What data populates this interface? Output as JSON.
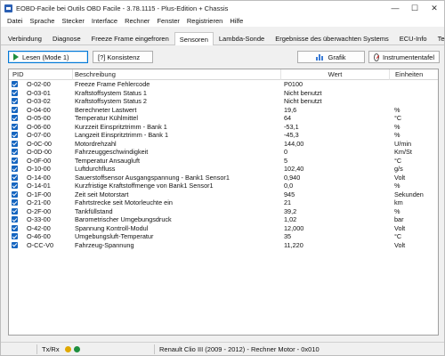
{
  "window": {
    "title": "EOBD-Facile bei Outils OBD Facile - 3.78.1115 - Plus-Edition + Chassis",
    "controls": {
      "minimize": "—",
      "maximize": "☐",
      "close": "✕"
    }
  },
  "menu": [
    "Datei",
    "Sprache",
    "Stecker",
    "Interface",
    "Rechner",
    "Fenster",
    "Registrieren",
    "Hilfe"
  ],
  "tabs": [
    "Verbindung",
    "Diagnose",
    "Freeze Frame eingefroren",
    "Sensoren",
    "Lambda-Sonde",
    "Ergebnisse des überwachten Systems",
    "ECU-Info",
    "Terminal"
  ],
  "active_tab": "Sensoren",
  "toolbar": {
    "read_label": "Lesen (Mode 1)",
    "consistency_label": "[?] Konsistenz",
    "chart_label": "Grafik",
    "dashboard_label": "Instrumententafel"
  },
  "table": {
    "columns": {
      "pid": "PID",
      "desc": "Beschreibung",
      "value": "Wert",
      "unit": "Einheiten"
    },
    "rows": [
      {
        "pid": "O-02-00",
        "desc": "Freeze Frame Fehlercode",
        "value": "P0100",
        "unit": ""
      },
      {
        "pid": "O-03-01",
        "desc": "Kraftstoffsystem Status 1",
        "value": "Nicht benutzt",
        "unit": ""
      },
      {
        "pid": "O-03-02",
        "desc": "Kraftstoffsystem Status 2",
        "value": "Nicht benutzt",
        "unit": ""
      },
      {
        "pid": "O-04-00",
        "desc": "Berechneter Lastwert",
        "value": "19,6",
        "unit": "%"
      },
      {
        "pid": "O-05-00",
        "desc": "Temperatur Kühlmittel",
        "value": "64",
        "unit": "°C"
      },
      {
        "pid": "O-06-00",
        "desc": "Kurzzeit Einspritztrimm - Bank 1",
        "value": "-53,1",
        "unit": "%"
      },
      {
        "pid": "O-07-00",
        "desc": "Langzeit Einspritztrimm - Bank 1",
        "value": "-45,3",
        "unit": "%"
      },
      {
        "pid": "O-0C-00",
        "desc": "Motordrehzahl",
        "value": "144,00",
        "unit": "U/min"
      },
      {
        "pid": "O-0D-00",
        "desc": "Fahrzeuggeschwindigkeit",
        "value": "0",
        "unit": "Km/St"
      },
      {
        "pid": "O-0F-00",
        "desc": "Temperatur Ansaugluft",
        "value": "5",
        "unit": "°C"
      },
      {
        "pid": "O-10-00",
        "desc": "Luftdurchfluss",
        "value": "102,40",
        "unit": "g/s"
      },
      {
        "pid": "O-14-00",
        "desc": "Sauerstoffsensor Ausgangspannung - Bank1 Sensor1",
        "value": "0,940",
        "unit": "Volt"
      },
      {
        "pid": "O-14-01",
        "desc": "Kurzfristige Kraftstoffmenge von Bank1 Sensor1",
        "value": "0,0",
        "unit": "%"
      },
      {
        "pid": "O-1F-00",
        "desc": "Zeit seit Motorstart",
        "value": "945",
        "unit": "Sekunden"
      },
      {
        "pid": "O-21-00",
        "desc": "Fahrtstrecke seit Motorleuchte ein",
        "value": "21",
        "unit": "km"
      },
      {
        "pid": "O-2F-00",
        "desc": "Tankfüllstand",
        "value": "39,2",
        "unit": "%"
      },
      {
        "pid": "O-33-00",
        "desc": "Barometrischer Umgebungsdruck",
        "value": "1,02",
        "unit": "bar"
      },
      {
        "pid": "O-42-00",
        "desc": "Spannung Kontroll-Modul",
        "value": "12,000",
        "unit": "Volt"
      },
      {
        "pid": "O-46-00",
        "desc": "Umgebungsluft-Temperatur",
        "value": "35",
        "unit": "°C"
      },
      {
        "pid": "O-CC-V0",
        "desc": "Fahrzeug-Spannung",
        "value": "11,220",
        "unit": "Volt"
      }
    ]
  },
  "status": {
    "txrx_label": "Tx/Rx",
    "led_colors": [
      "#e0a800",
      "#1e8e3e"
    ],
    "vehicle": "Renault Clio III (2009 - 2012) - Rechner Motor - 0x010"
  }
}
